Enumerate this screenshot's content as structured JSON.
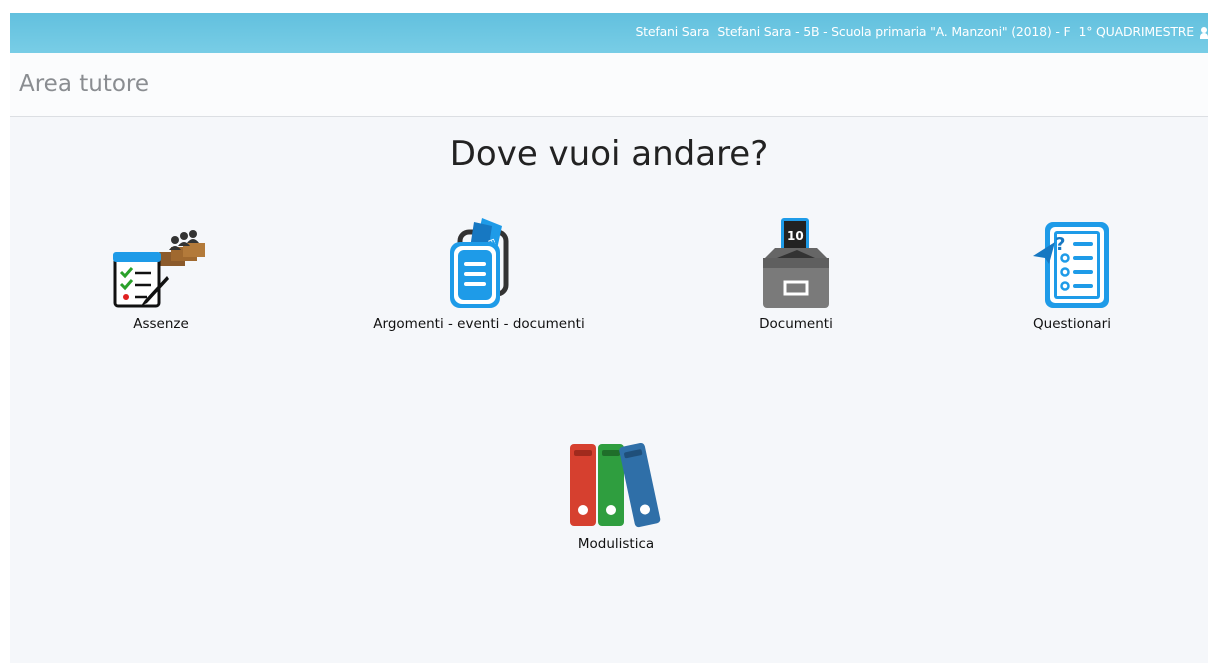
{
  "topbar": {
    "user_short": "Stefani Sara",
    "context": "Stefani Sara - 5B - Scuola primaria \"A. Manzoni\" (2018) - F",
    "period": "1° QUADRIMESTRE"
  },
  "header": {
    "title": "Area tutore"
  },
  "main": {
    "question": "Dove vuoi andare?",
    "tiles": [
      {
        "label": "Assenze",
        "icon": "attendance-icon"
      },
      {
        "label": "Argomenti - eventi - documenti",
        "icon": "topics-events-icon"
      },
      {
        "label": "Documenti",
        "icon": "document-archive-icon"
      },
      {
        "label": "Questionari",
        "icon": "questionnaire-icon"
      },
      {
        "label": "Modulistica",
        "icon": "binders-icon"
      }
    ]
  },
  "colors": {
    "topbar": "#6ac5e2",
    "icon_blue": "#1e9be8",
    "binder_red": "#d6402f",
    "binder_green": "#2f9e3f",
    "binder_blue": "#2f6fa8"
  }
}
